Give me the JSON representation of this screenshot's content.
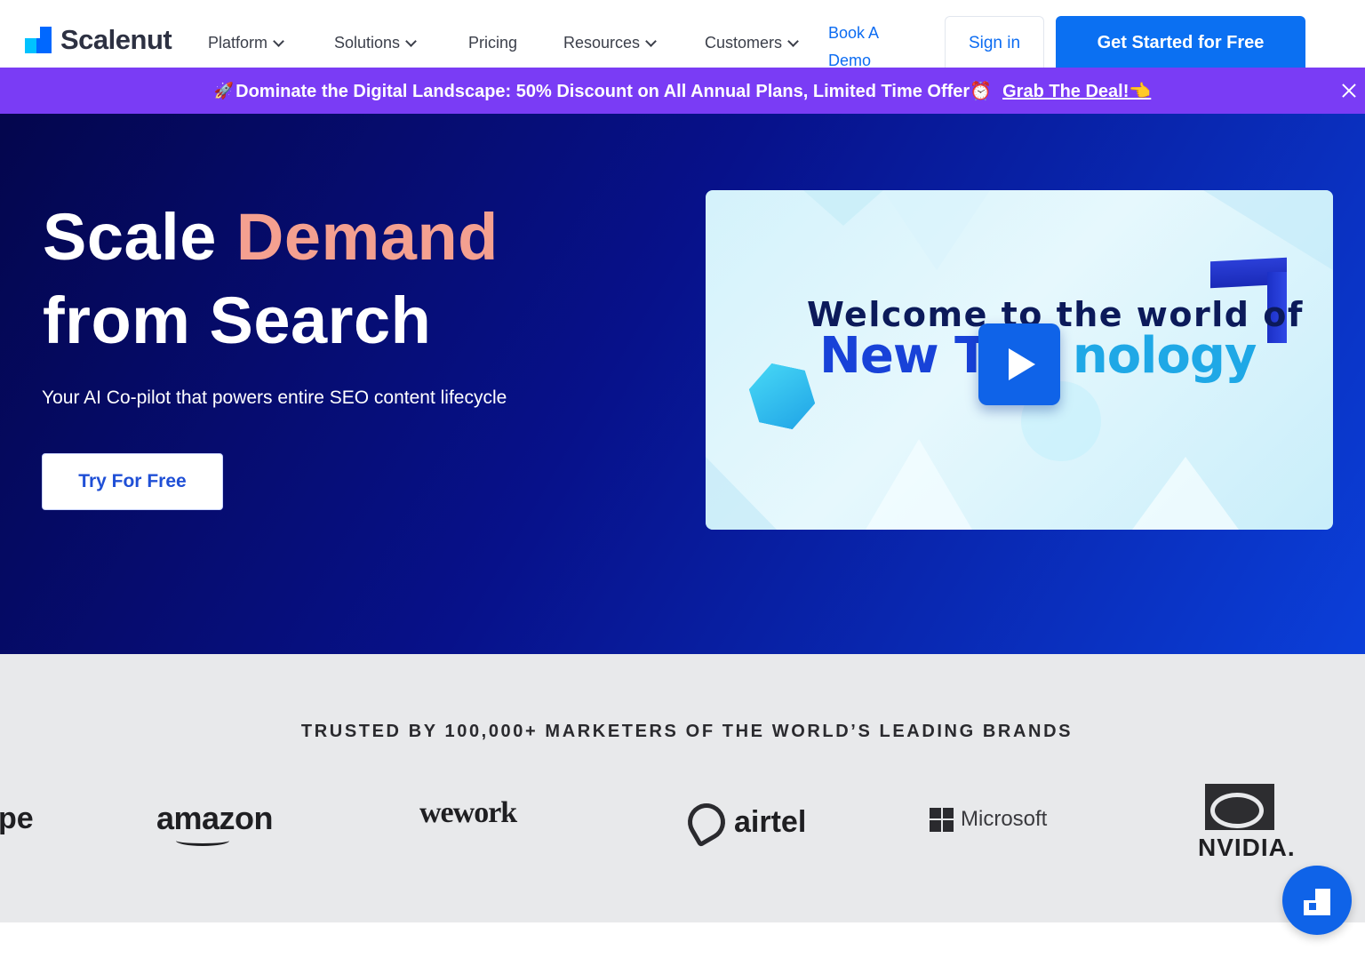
{
  "brand": {
    "name": "Scalenut"
  },
  "nav": {
    "platform": "Platform",
    "solutions": "Solutions",
    "pricing": "Pricing",
    "resources": "Resources",
    "customers": "Customers",
    "book_demo": "Book A Demo",
    "sign_in": "Sign in",
    "get_started": "Get Started for Free"
  },
  "promo": {
    "rocket": "🚀",
    "text": "Dominate the Digital Landscape: 50% Discount on All Annual Plans, Limited Time Offer⏰",
    "link": "Grab The Deal!👈"
  },
  "hero": {
    "title_line1_a": "Scale",
    "title_line1_b": "Demand",
    "title_line2": "from Search",
    "subtitle": "Your AI Co-pilot that powers entire SEO content lifecycle",
    "cta": "Try For Free"
  },
  "video": {
    "welcome": "Welcome to the world of",
    "new_tech_a": "New Te",
    "new_tech_b": "nology"
  },
  "trusted": {
    "title": "TRUSTED BY 100,000+ MARKETERS OF THE WORLD’S LEADING BRANDS",
    "brands": {
      "partial": "pe",
      "amazon": "amazon",
      "wework": "wework",
      "airtel": "airtel",
      "microsoft": "Microsoft",
      "nvidia": "NVIDIA."
    }
  },
  "colors": {
    "primary": "#0b70f2",
    "promo_bg": "#7a3cf5",
    "hero_dark": "#04064d",
    "hero_light": "#0b3fd9",
    "accent": "#f4a090"
  }
}
